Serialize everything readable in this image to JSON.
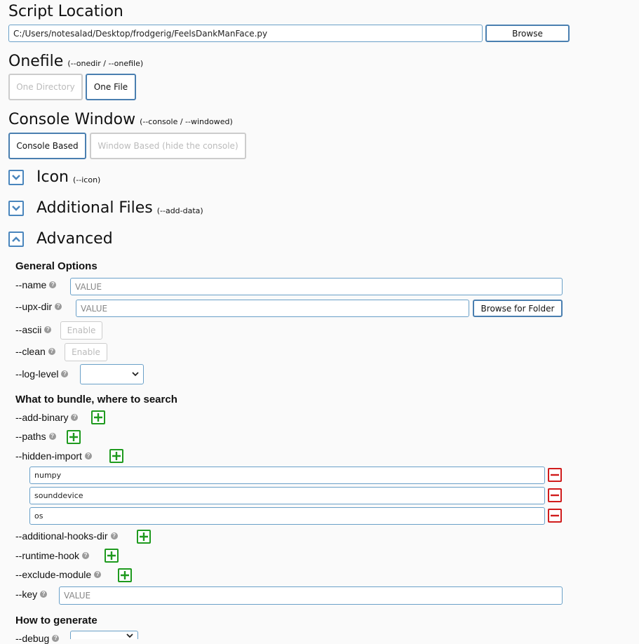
{
  "script_location": {
    "heading": "Script Location",
    "path_value": "C:/Users/notesalad/Desktop/frodgerig/FeelsDankManFace.py",
    "browse_label": "Browse"
  },
  "onefile": {
    "heading": "Onefile",
    "note": "(--onedir / --onefile)",
    "options": [
      "One Directory",
      "One File"
    ],
    "selected": "One File"
  },
  "console": {
    "heading": "Console Window",
    "note": "(--console / --windowed)",
    "options": [
      "Console Based",
      "Window Based (hide the console)"
    ],
    "selected": "Console Based"
  },
  "collapsibles": [
    {
      "title": "Icon",
      "note": "(--icon)",
      "expanded": false
    },
    {
      "title": "Additional Files",
      "note": "(--add-data)",
      "expanded": false
    },
    {
      "title": "Advanced",
      "note": "",
      "expanded": true
    }
  ],
  "advanced": {
    "general": {
      "title": "General Options",
      "name_label": "--name",
      "name_placeholder": "VALUE",
      "upx_label": "--upx-dir",
      "upx_placeholder": "VALUE",
      "upx_browse": "Browse for Folder",
      "ascii_label": "--ascii",
      "ascii_button": "Enable",
      "clean_label": "--clean",
      "clean_button": "Enable",
      "log_label": "--log-level",
      "log_value": ""
    },
    "bundle": {
      "title": "What to bundle, where to search",
      "add_binary": "--add-binary",
      "paths": "--paths",
      "hidden_import": "--hidden-import",
      "hidden_imports": [
        "numpy",
        "sounddevice",
        "os"
      ],
      "hooks_dir": "--additional-hooks-dir",
      "runtime_hook": "--runtime-hook",
      "exclude_module": "--exclude-module",
      "key_label": "--key",
      "key_placeholder": "VALUE"
    },
    "generate": {
      "title": "How to generate",
      "debug_label": "--debug"
    }
  },
  "icons": {
    "help": "question-icon",
    "add": "plus-icon",
    "remove": "minus-icon",
    "chevron_down": "chevron-down-icon",
    "chevron_up": "chevron-up-icon"
  },
  "colors": {
    "accent": "#4a7fb0",
    "add": "#1e9a1e",
    "remove": "#d01c1c"
  }
}
